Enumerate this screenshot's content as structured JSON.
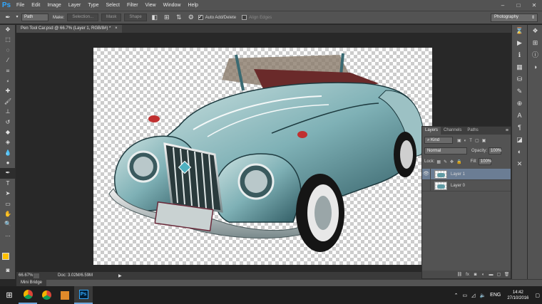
{
  "app": {
    "logo": "Ps"
  },
  "menu": [
    "File",
    "Edit",
    "Image",
    "Layer",
    "Type",
    "Select",
    "Filter",
    "View",
    "Window",
    "Help"
  ],
  "window_controls": [
    "–",
    "□",
    "✕"
  ],
  "options": {
    "mode": "Path",
    "make_label": "Make:",
    "selection_btn": "Selection...",
    "mask_btn": "Mask",
    "shape_btn": "Shape",
    "auto_add_delete": "Auto Add/Delete",
    "align_edges": "Align Edges",
    "workspace": "Photography"
  },
  "document": {
    "tab_title": "Pen Tool Car.psd @ 66.7% (Layer 1, RGB/8#) *",
    "close": "×",
    "zoom": "66.67%",
    "doc_size": "Doc: 3.02M/6.59M"
  },
  "minibridge": {
    "label": "Mini Bridge"
  },
  "layers_panel": {
    "tabs": [
      "Layers",
      "Channels",
      "Paths"
    ],
    "kind": "Kind",
    "blend_mode": "Normal",
    "opacity_label": "Opacity:",
    "opacity_value": "100%",
    "lock_label": "Lock:",
    "fill_label": "Fill:",
    "fill_value": "100%",
    "layers": [
      {
        "name": "Layer 1",
        "visible": true,
        "selected": true
      },
      {
        "name": "Layer 0",
        "visible": false,
        "selected": false
      }
    ]
  },
  "taskbar": {
    "tray_lang": "ENG",
    "time": "14:42",
    "date": "27/10/2016"
  },
  "colors": {
    "foreground": "#ffc000",
    "background": "#000000",
    "accent": "#31a8ff"
  }
}
